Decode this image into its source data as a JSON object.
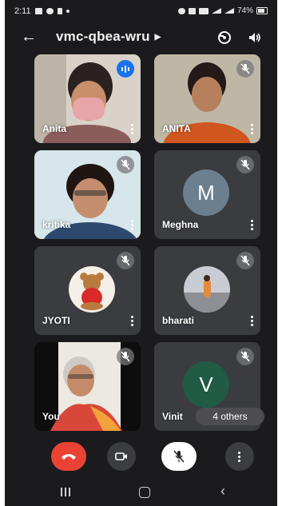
{
  "status_bar": {
    "time": "2:11",
    "battery": "74%"
  },
  "app_bar": {
    "meeting_code": "vmc-qbea-wru"
  },
  "participants": [
    {
      "name": "Anita",
      "state": "speaking"
    },
    {
      "name": "ANITA",
      "state": "muted"
    },
    {
      "name": "kritika",
      "state": "muted"
    },
    {
      "name": "Meghna",
      "state": "muted",
      "initial": "M",
      "avatar_color": "#6b7f8f"
    },
    {
      "name": "JYOTI",
      "state": "muted"
    },
    {
      "name": "bharati",
      "state": "muted"
    },
    {
      "name": "You",
      "state": "muted"
    },
    {
      "name": "Vinit",
      "state": "muted",
      "initial": "V",
      "avatar_color": "#1f5b45"
    }
  ],
  "others_label": "4 others",
  "colors": {
    "end_call": "#ea4335",
    "speaking_badge": "#1a73e8",
    "background": "#1b1b1d"
  }
}
